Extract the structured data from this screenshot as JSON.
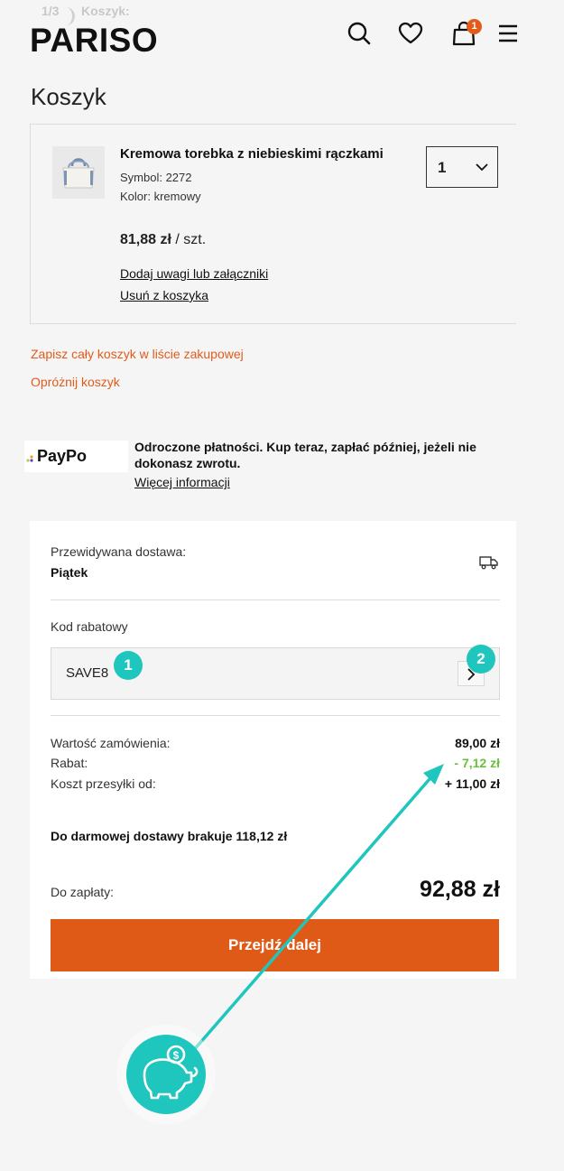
{
  "header": {
    "step_number": "1/3",
    "step_label": "Koszyk:",
    "logo": "PARISO",
    "cart_count": "1",
    "icons": [
      "search-icon",
      "heart-icon",
      "bag-icon",
      "menu-icon"
    ]
  },
  "page_title": "Koszyk",
  "item": {
    "name": "Kremowa torebka z niebieskimi rączkami",
    "symbol": "Symbol: 2272",
    "color": "Kolor: kremowy",
    "quantity": "1",
    "price": "81,88 zł",
    "price_unit": " / szt.",
    "add_notes": "Dodaj uwagi lub załączniki",
    "remove": "Usuń z koszyka"
  },
  "links": {
    "save_cart": "Zapisz cały koszyk w liście zakupowej",
    "empty_cart": "Opróżnij koszyk"
  },
  "paypo": {
    "logo_text": "PayPo",
    "text": "Odroczone płatności. Kup teraz, zapłać później, jeżeli nie dokonasz zwrotu.",
    "more": "Więcej informacji"
  },
  "summary": {
    "delivery_label": "Przewidywana dostawa:",
    "delivery_day": "Piątek",
    "coupon_label": "Kod rabatowy",
    "coupon_value": "SAVE8",
    "order_value_label": "Wartość zamówienia:",
    "order_value": "89,00 zł",
    "discount_label": "Rabat:",
    "discount_value": "- 7,12 zł",
    "shipping_label": "Koszt przesyłki od:",
    "shipping_value": "+ 11,00 zł",
    "free_shipping": "Do darmowej dostawy brakuje 118,12 zł",
    "to_pay_label": "Do zapłaty:",
    "to_pay_value": "92,88 zł",
    "cta": "Przejdź dalej"
  },
  "annotations": {
    "marker_1": "1",
    "marker_2": "2",
    "accent": "#1fc6bd",
    "icon": "piggy-bank-coin-icon"
  },
  "colors": {
    "brand_orange": "#e05a17",
    "discount_green": "#6bbf3b",
    "background": "#f5f5f5"
  }
}
